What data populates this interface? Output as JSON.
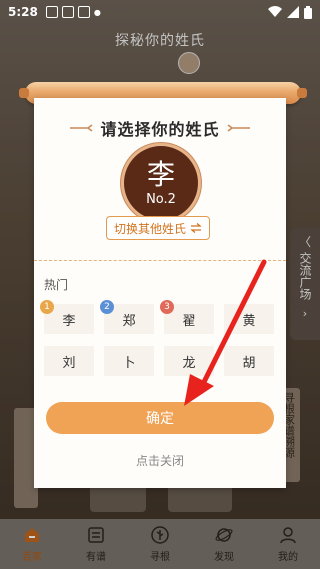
{
  "status_bar": {
    "time": "5:28"
  },
  "background": {
    "page_title": "探秘你的姓氏",
    "side_tab_label": "交流广场",
    "side_tab2_label": "寻根家谱溯源"
  },
  "modal": {
    "title": "请选择你的姓氏",
    "selected_surname": "李",
    "selected_rank": "No.2",
    "switch_label": "切换其他姓氏",
    "switch_icon": "swap-arrows-icon",
    "hot_label": "热门",
    "surnames": [
      {
        "name": "李",
        "rank": "1",
        "badge_color": "#e8a74a"
      },
      {
        "name": "郑",
        "rank": "2",
        "badge_color": "#5b8fd6"
      },
      {
        "name": "翟",
        "rank": "3",
        "badge_color": "#e06a5a"
      },
      {
        "name": "黄",
        "rank": ""
      },
      {
        "name": "刘",
        "rank": ""
      },
      {
        "name": "卜",
        "rank": ""
      },
      {
        "name": "龙",
        "rank": ""
      },
      {
        "name": "胡",
        "rank": ""
      }
    ],
    "confirm_label": "确定",
    "close_label": "点击关闭",
    "accent_color": "#f0a355",
    "seal_color": "#5a2a16"
  },
  "annotation": {
    "arrow_color": "#e8231e"
  },
  "bottom_nav": [
    {
      "label": "百家",
      "icon": "home-icon",
      "active": true
    },
    {
      "label": "有谱",
      "icon": "book-icon",
      "active": false
    },
    {
      "label": "寻根",
      "icon": "tree-icon",
      "active": false
    },
    {
      "label": "发现",
      "icon": "planet-icon",
      "active": false
    },
    {
      "label": "我的",
      "icon": "person-icon",
      "active": false
    }
  ]
}
